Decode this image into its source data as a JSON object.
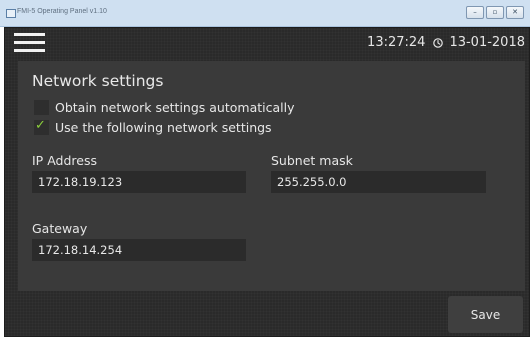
{
  "window": {
    "title": "FMI-5 Operating Panel v1.10",
    "controls": [
      "–",
      "▫",
      "✕"
    ]
  },
  "header": {
    "menu_icon": "hamburger-menu-icon",
    "time": "13:27:24",
    "clock_icon": "clock-icon",
    "date": "13-01-2018"
  },
  "network": {
    "title": "Network settings",
    "option_auto": {
      "label": "Obtain network settings automatically",
      "checked": false
    },
    "option_manual": {
      "label": "Use the following network settings",
      "checked": true
    },
    "ip_label": "IP Address",
    "ip_value": "172.18.19.123",
    "subnet_label": "Subnet mask",
    "subnet_value": "255.255.0.0",
    "gateway_label": "Gateway",
    "gateway_value": "172.18.14.254"
  },
  "actions": {
    "save_label": "Save"
  },
  "colors": {
    "background": "#2a2a2a",
    "panel": "#3a3a3a",
    "input": "#2b2b2b",
    "check_accent": "#8ccf3c",
    "titlebar": "#cfe0f1"
  }
}
